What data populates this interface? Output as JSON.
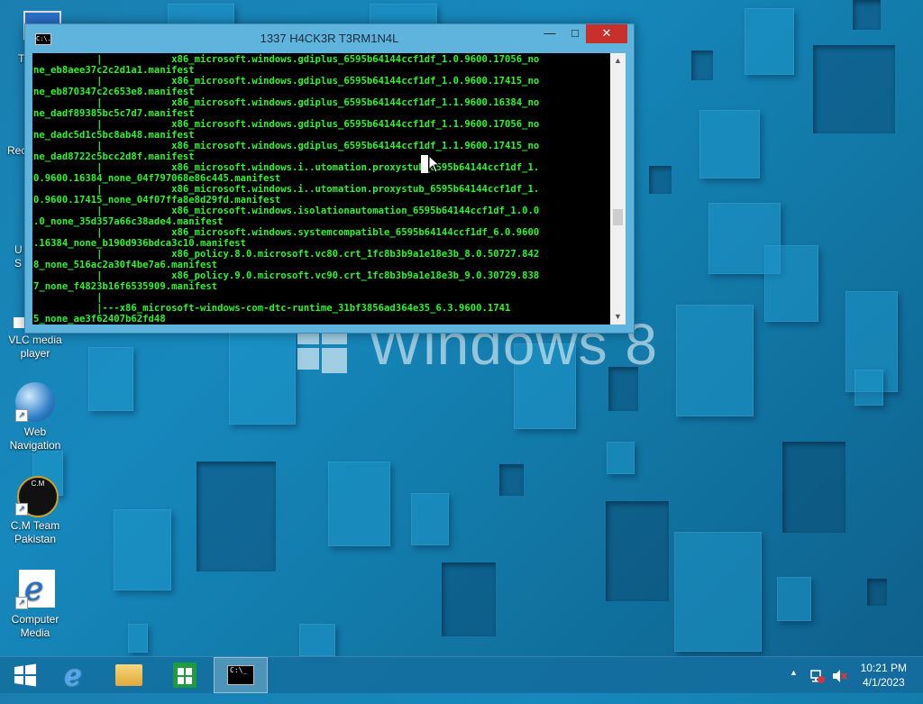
{
  "desktop": {
    "icons": [
      {
        "label": "T",
        "name": "desktop-icon-this-pc"
      },
      {
        "label": "Rec",
        "name": "desktop-icon-recycle-bin"
      },
      {
        "label": "U S",
        "name": "desktop-icon-user-settings"
      },
      {
        "label": "VLC media player",
        "name": "desktop-icon-vlc"
      },
      {
        "label": "Web Navigation",
        "name": "desktop-icon-web-navigation"
      },
      {
        "label": "C.M Team Pakistan",
        "name": "desktop-icon-cm-team"
      },
      {
        "label": "Computer Media",
        "name": "desktop-icon-computer-media"
      }
    ],
    "wallpaper_text": "Windows 8"
  },
  "console": {
    "icon_text": "C:\\.",
    "title": "1337 H4CK3R T3RM1N4L",
    "minimize": "—",
    "maximize": "□",
    "close": "✕",
    "lines": [
      "           |            x86_microsoft.windows.gdiplus_6595b64144ccf1df_1.0.9600.17056_no",
      "ne_eb8aee37c2c2d1a1.manifest",
      "           |            x86_microsoft.windows.gdiplus_6595b64144ccf1df_1.0.9600.17415_no",
      "ne_eb870347c2c653e8.manifest",
      "           |            x86_microsoft.windows.gdiplus_6595b64144ccf1df_1.1.9600.16384_no",
      "ne_dadf89385bc5c7d7.manifest",
      "           |            x86_microsoft.windows.gdiplus_6595b64144ccf1df_1.1.9600.17056_no",
      "ne_dadc5d1c5bc8ab48.manifest",
      "           |            x86_microsoft.windows.gdiplus_6595b64144ccf1df_1.1.9600.17415_no",
      "ne_dad8722c5bcc2d8f.manifest",
      "           |            x86_microsoft.windows.i..utomation.proxystub_6595b64144ccf1df_1.",
      "0.9600.16384_none_04f797068e86c445.manifest",
      "           |            x86_microsoft.windows.i..utomation.proxystub_6595b64144ccf1df_1.",
      "0.9600.17415_none_04f07ffa8e8d29fd.manifest",
      "           |            x86_microsoft.windows.isolationautomation_6595b64144ccf1df_1.0.0",
      ".0_none_35d357a66c38ade4.manifest",
      "           |            x86_microsoft.windows.systemcompatible_6595b64144ccf1df_6.0.9600",
      ".16384_none_b190d936bdca3c10.manifest",
      "           |            x86_policy.8.0.microsoft.vc80.crt_1fc8b3b9a1e18e3b_8.0.50727.842",
      "8_none_516ac2a30f4be7a6.manifest",
      "           |            x86_policy.9.0.microsoft.vc90.crt_1fc8b3b9a1e18e3b_9.0.30729.838",
      "7_none_f4823b16f6535909.manifest",
      "           |",
      "           |---x86_microsoft-windows-com-dtc-runtime_31bf3856ad364e35_6.3.9600.1741",
      "5_none_ae3f62407b62fd48"
    ]
  },
  "taskbar": {
    "buttons": [
      {
        "name": "start-button"
      },
      {
        "name": "taskbar-internet-explorer"
      },
      {
        "name": "taskbar-file-explorer"
      },
      {
        "name": "taskbar-store"
      },
      {
        "name": "taskbar-console"
      }
    ],
    "console_icon_text": "C:\\_",
    "tray": {
      "show_hidden": "▲",
      "time": "10:21 PM",
      "date": "4/1/2023"
    }
  },
  "colors": {
    "terminal_text": "#2cf52c",
    "terminal_bg": "#000000",
    "close_button": "#c7302b"
  }
}
